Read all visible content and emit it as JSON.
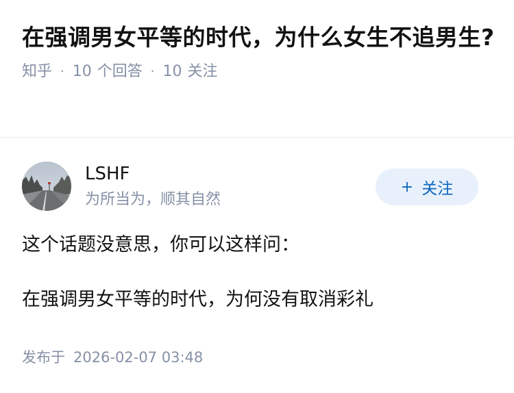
{
  "question": {
    "title": "在强调男女平等的时代，为什么女生不追男生?",
    "meta": {
      "source": "知乎",
      "separator": "·",
      "answers_count": "10",
      "answers_label": "个回答",
      "follows_count": "10",
      "follows_label": "关注"
    }
  },
  "author": {
    "name": "LSHF",
    "bio": "为所当为，顺其自然",
    "avatar_icon": "avatar-photo-icon",
    "follow_button": {
      "plus_symbol": "+",
      "label": "关注"
    }
  },
  "answer": {
    "paragraphs": [
      "这个话题没意思，你可以这样问：",
      "在强调男女平等的时代，为何没有取消彩礼"
    ],
    "publish_label": "发布于",
    "publish_time": "2026-02-07 03:48"
  },
  "colors": {
    "text_primary": "#121212",
    "text_secondary": "#8590a6",
    "follow_bg": "#e8f1fb",
    "follow_text": "#0d63c0",
    "divider": "#ebebeb"
  }
}
